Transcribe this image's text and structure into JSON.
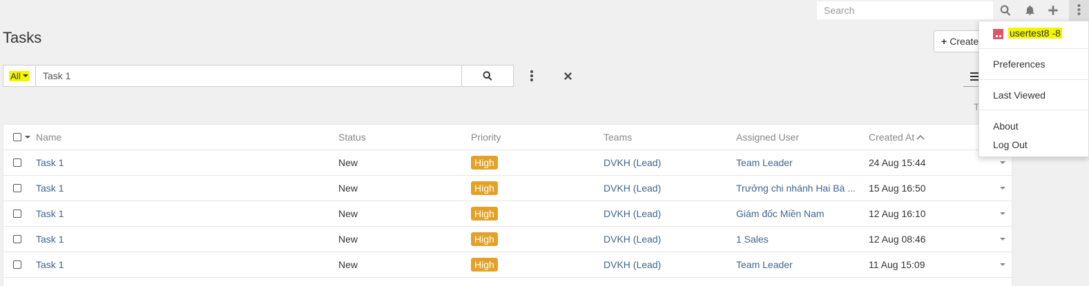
{
  "topbar": {
    "search_placeholder": "Search"
  },
  "page": {
    "title": "Tasks",
    "create_label": "Create"
  },
  "filter": {
    "scope_label": "All",
    "query_value": "Task 1",
    "total_label_partial": "T"
  },
  "table": {
    "headers": {
      "name": "Name",
      "status": "Status",
      "priority": "Priority",
      "teams": "Teams",
      "assigned_user": "Assigned User",
      "created_at": "Created At"
    },
    "rows": [
      {
        "name": "Task 1",
        "status": "New",
        "priority": "High",
        "teams": "DVKH (Lead)",
        "assigned_user": "Team Leader",
        "created_at": "24 Aug 15:44"
      },
      {
        "name": "Task 1",
        "status": "New",
        "priority": "High",
        "teams": "DVKH (Lead)",
        "assigned_user": "Trưởng chi nhánh Hai Bà ...",
        "created_at": "15 Aug 16:50"
      },
      {
        "name": "Task 1",
        "status": "New",
        "priority": "High",
        "teams": "DVKH (Lead)",
        "assigned_user": "Giám đốc Miền Nam",
        "created_at": "12 Aug 16:10"
      },
      {
        "name": "Task 1",
        "status": "New",
        "priority": "High",
        "teams": "DVKH (Lead)",
        "assigned_user": "1 Sales",
        "created_at": "12 Aug 08:46"
      },
      {
        "name": "Task 1",
        "status": "New",
        "priority": "High",
        "teams": "DVKH (Lead)",
        "assigned_user": "Team Leader",
        "created_at": "11 Aug 15:09"
      }
    ]
  },
  "user_menu": {
    "username": "usertest8 -8",
    "items": [
      "Preferences",
      "Last Viewed",
      "About",
      "Log Out"
    ]
  },
  "colors": {
    "priority_high": "#e3a227",
    "link": "#3d6690",
    "highlight": "#f5f500",
    "avatar": "#e05565"
  }
}
